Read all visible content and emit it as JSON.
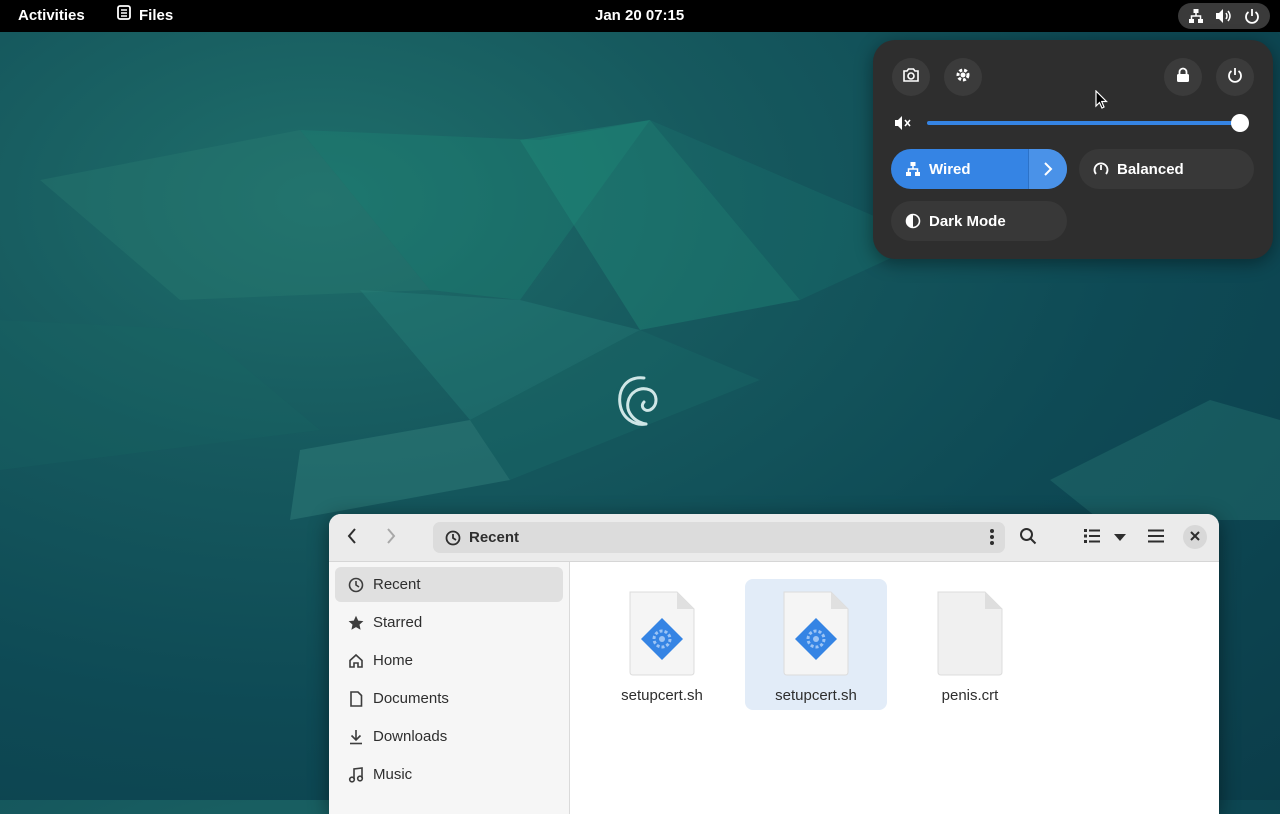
{
  "topbar": {
    "activities": "Activities",
    "app_name": "Files",
    "clock": "Jan 20  07:15"
  },
  "quick_settings": {
    "volume_percent": 100,
    "network_label": "Wired",
    "power_mode_label": "Balanced",
    "dark_mode_label": "Dark Mode"
  },
  "files_window": {
    "path_label": "Recent",
    "sidebar": [
      {
        "label": "Recent",
        "icon": "clock-icon",
        "active": true
      },
      {
        "label": "Starred",
        "icon": "star-icon"
      },
      {
        "label": "Home",
        "icon": "home-icon"
      },
      {
        "label": "Documents",
        "icon": "document-icon"
      },
      {
        "label": "Downloads",
        "icon": "download-icon"
      },
      {
        "label": "Music",
        "icon": "music-icon"
      }
    ],
    "files": [
      {
        "name": "setupcert.sh",
        "icon": "script-file-icon",
        "selected": false
      },
      {
        "name": "setupcert.sh",
        "icon": "script-file-icon",
        "selected": true
      },
      {
        "name": "penis.crt",
        "icon": "generic-file-icon",
        "selected": false
      }
    ]
  },
  "colors": {
    "accent": "#3584e4",
    "panel": "#2e2e2e",
    "topbar": "#000000"
  }
}
